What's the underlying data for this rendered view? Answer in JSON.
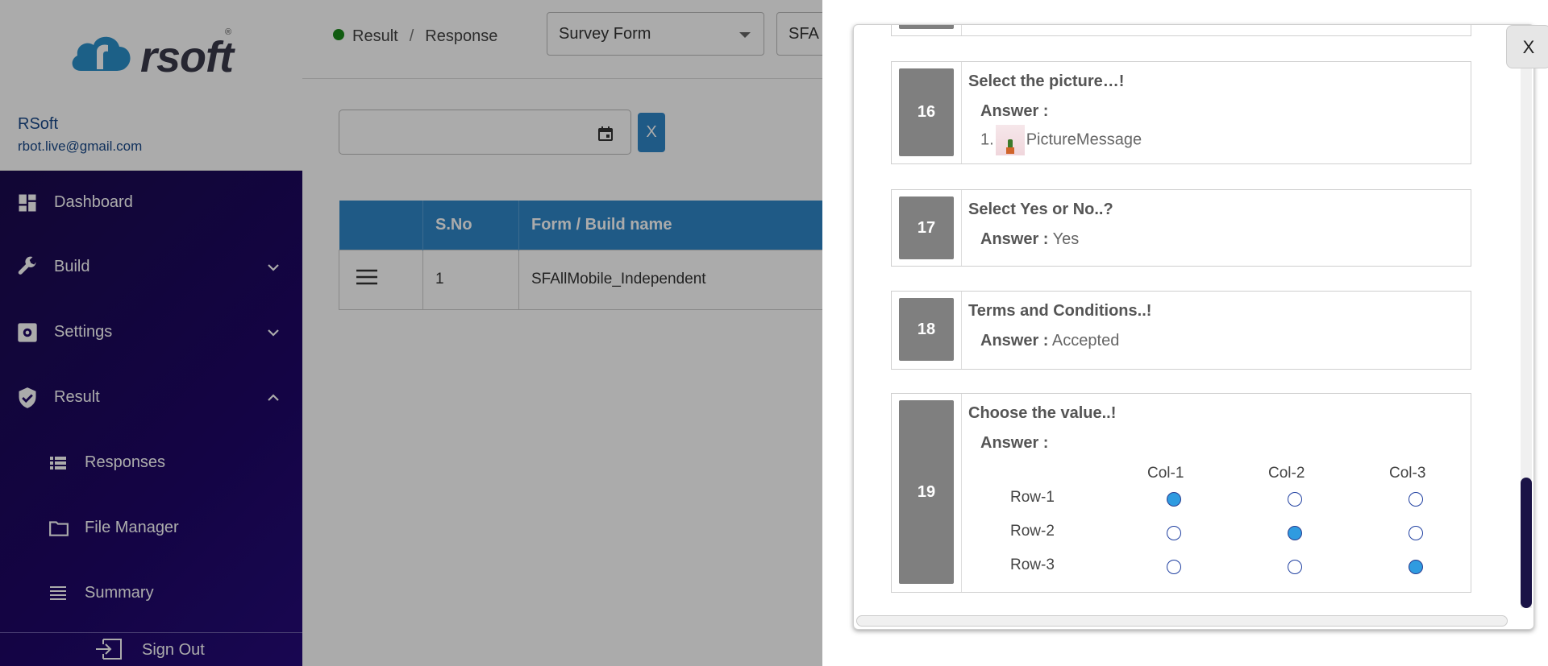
{
  "sidebar": {
    "brand": "rsoft",
    "user": {
      "name": "RSoft",
      "email": "rbot.live@gmail.com"
    },
    "items": [
      {
        "label": "Dashboard",
        "icon": "dashboard-icon"
      },
      {
        "label": "Build",
        "icon": "wrench-icon",
        "chevron": "down"
      },
      {
        "label": "Settings",
        "icon": "gear-icon",
        "chevron": "down"
      },
      {
        "label": "Result",
        "icon": "shield-check-icon",
        "chevron": "up"
      },
      {
        "label": "Responses",
        "icon": "list-icon"
      },
      {
        "label": "File Manager",
        "icon": "folder-icon"
      },
      {
        "label": "Summary",
        "icon": "lines-icon"
      }
    ],
    "signout": "Sign Out"
  },
  "header": {
    "breadcrumb": [
      "Result",
      "Response"
    ],
    "select1": "Survey Form",
    "select2": "SFA"
  },
  "filters": {
    "clear_label": "X"
  },
  "table": {
    "headers": [
      "",
      "S.No",
      "Form / Build name"
    ],
    "rows": [
      {
        "sno": "1",
        "name": "SFAllMobile_Independent"
      }
    ]
  },
  "modal": {
    "close_label": "X",
    "answer_label": "Answer :",
    "questions": [
      {
        "num": "16",
        "text": "Select the picture…!",
        "answer_index": "1.",
        "answer": "PictureMessage"
      },
      {
        "num": "17",
        "text": "Select Yes or No..?",
        "answer": "Yes"
      },
      {
        "num": "18",
        "text": "Terms and Conditions..!",
        "answer": "Accepted"
      },
      {
        "num": "19",
        "text": "Choose the value..!",
        "columns": [
          "Col-1",
          "Col-2",
          "Col-3"
        ],
        "rows": [
          "Row-1",
          "Row-2",
          "Row-3"
        ],
        "selected": [
          0,
          1,
          2
        ]
      }
    ]
  },
  "colors": {
    "accent": "#2f86c8",
    "sidebar": "#1e0766",
    "radio_selected": "#2f9be0"
  }
}
